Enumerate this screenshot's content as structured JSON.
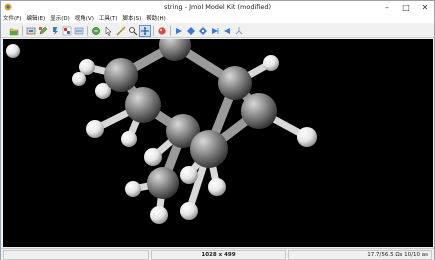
{
  "window": {
    "title": "string - Jmol Model Kit (modified)"
  },
  "menubar": {
    "items": [
      {
        "label": "文件(F)"
      },
      {
        "label": "编辑(E)"
      },
      {
        "label": "显示(D)"
      },
      {
        "label": "视角(V)"
      },
      {
        "label": "工具(T)"
      },
      {
        "label": "脚本(S)"
      },
      {
        "label": "帮助(H)"
      }
    ]
  },
  "toolbar": {
    "icons": [
      "open-icon",
      "screenshot-icon",
      "edit-icon",
      "script-icon",
      "image-icon",
      "console-icon",
      "undo-icon",
      "select-icon",
      "measure-icon",
      "rotate-icon",
      "move-icon",
      "model-kit-icon",
      "front-icon",
      "top-icon",
      "bottom-icon",
      "right-icon",
      "left-icon",
      "axis-icon"
    ]
  },
  "statusbar": {
    "panel_left": "",
    "dimensions": "1028 x 499",
    "fps_info": "17.7/56.5 Ωs   10/10 as"
  },
  "colors": {
    "viewport_background": "#000000",
    "carbon": "#8c8c8c",
    "hydrogen": "#f2f2f2"
  }
}
